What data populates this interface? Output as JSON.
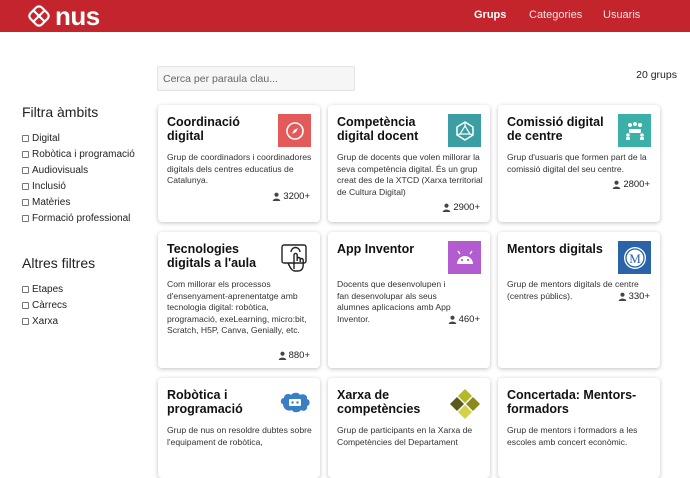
{
  "header": {
    "logo_text": "nus",
    "nav": [
      {
        "label": "Grups",
        "active": true
      },
      {
        "label": "Categories",
        "active": false
      },
      {
        "label": "Usuaris",
        "active": false
      }
    ],
    "brand_color": "#c4252c"
  },
  "search": {
    "placeholder": "Cerca per paraula clau..."
  },
  "results": {
    "count_label": "20 grups"
  },
  "sidebar": {
    "ambits_title": "Filtra àmbits",
    "ambits": [
      "Digital",
      "Robòtica i programació",
      "Audiovisuals",
      "Inclusió",
      "Matèries",
      "Formació professional"
    ],
    "altres_title": "Altres filtres",
    "altres": [
      "Etapes",
      "Càrrecs",
      "Xarxa"
    ]
  },
  "cards": [
    {
      "title": "Coordinació digital",
      "description": "Grup de coordinadors i coordinadores digitals dels centres educatius de Catalunya.",
      "members": "3200+",
      "icon": "compass-icon",
      "icon_color": "#e45a5a"
    },
    {
      "title": "Competència digital docent",
      "description": "Grup de docents que volen millorar la seva competència digital. És un grup creat des de la XTCD (Xarxa territorial de Cultura Digital)",
      "members": "2900+",
      "icon": "dice-icon",
      "icon_color": "#3a9ea3"
    },
    {
      "title": "Comissió digital de centre",
      "description": "Grup d'usuaris que formen part de la comissió digital del seu centre.",
      "members": "2800+",
      "icon": "meeting-icon",
      "icon_color": "#3ab0a8"
    },
    {
      "title": "Tecnologies digitals a l'aula",
      "description": "Com millorar els processos d'ensenyament-aprenentatge amb tecnologia digital: robòtica, programació, exeLearning, micro:bit, Scratch, H5P, Canva, Genially, etc.",
      "members": "880+",
      "icon": "touch-screen-icon",
      "icon_color": "#222222"
    },
    {
      "title": "App Inventor",
      "description": "Docents que desenvolupen i fan desenvolupar als seus alumnes aplicacions amb App Inventor.",
      "members": "460+",
      "icon": "android-icon",
      "icon_color": "#b35ccf"
    },
    {
      "title": "Mentors digitals",
      "description": "Grup de mentors digitals de centre (centres públics).",
      "members": "330+",
      "icon": "mentor-badge-icon",
      "icon_color": "#2b63a8"
    },
    {
      "title": "Robòtica i programació",
      "description": "Grup de nus on resoldre dubtes sobre l'equipament de robòtica,",
      "members": "",
      "icon": "robot-brain-icon",
      "icon_color": "#3a7fc4"
    },
    {
      "title": "Xarxa de competències",
      "description": "Grup de participants en la Xarxa de Competències del Departament",
      "members": "",
      "icon": "network-diamond-icon",
      "icon_color": "#8a8a1a"
    },
    {
      "title": "Concertada: Mentors-formadors",
      "description": "Grup de mentors i formadors a les escoles amb concert econòmic.",
      "members": "",
      "icon": "",
      "icon_color": ""
    }
  ]
}
